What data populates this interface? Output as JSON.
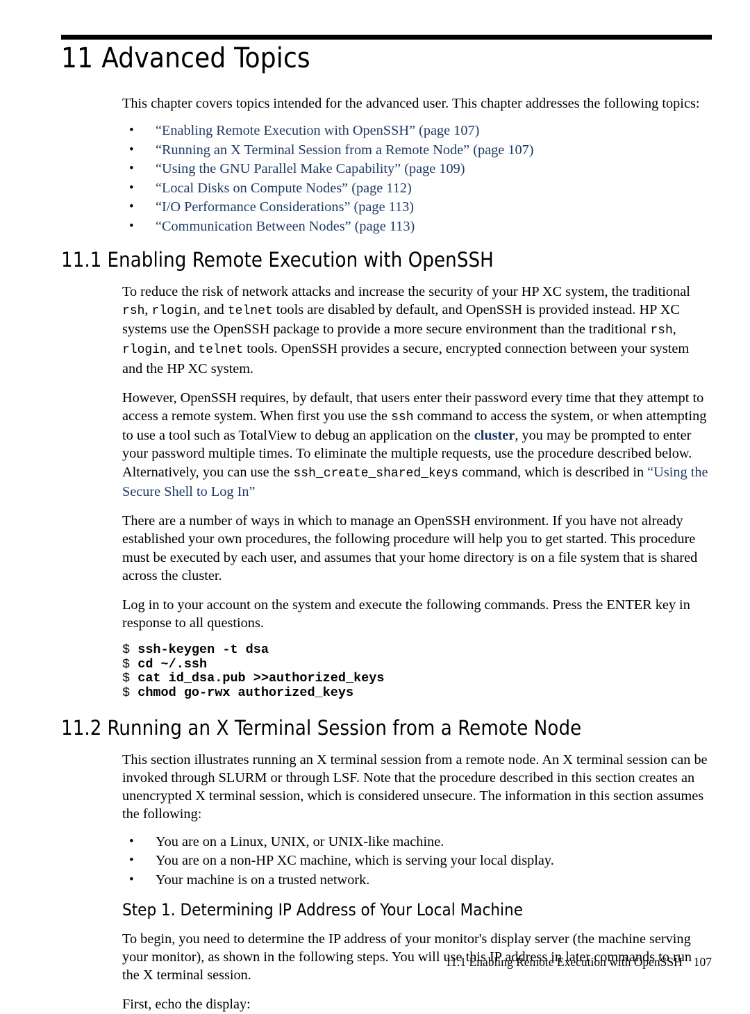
{
  "document": {
    "chapter_number": "11",
    "chapter_title": "Advanced Topics",
    "intro": "This chapter covers topics intended for the advanced user. This chapter addresses the following topics:",
    "topic_links": [
      "“Enabling Remote Execution with OpenSSH” (page 107)",
      "“Running an X Terminal Session from a Remote Node” (page 107)",
      "“Using the GNU Parallel Make Capability” (page 109)",
      "“Local Disks on Compute Nodes” (page 112)",
      "“I/O Performance Considerations” (page 113)",
      "“Communication Between Nodes” (page 113)"
    ]
  },
  "section_11_1": {
    "number": "11.1",
    "title": "Enabling Remote Execution with OpenSSH",
    "para1": {
      "t1": "To reduce the risk of network attacks and increase the security of your HP XC system, the traditional ",
      "c1": "rsh",
      "t2": ", ",
      "c2": "rlogin",
      "t3": ", and ",
      "c3": "telnet",
      "t4": " tools are disabled by default, and OpenSSH is provided instead. HP XC systems use the OpenSSH package to provide a more secure environment than the traditional ",
      "c4": "rsh",
      "t5": ", ",
      "c5": "rlogin",
      "t6": ", and ",
      "c6": "telnet",
      "t7": " tools. OpenSSH provides a secure, encrypted connection between your system and the HP XC system."
    },
    "para2": {
      "t1": "However, OpenSSH requires, by default, that users enter their password every time that they attempt to access a remote system. When first you use the ",
      "c1": "ssh",
      "t2": " command to access the system, or when attempting to use a tool such as TotalView to debug an application on the ",
      "term": "cluster",
      "t3": ", you may be prompted to enter your password multiple times. To eliminate the multiple requests, use the procedure described below. Alternatively, you can use the ",
      "c2": "ssh_create_shared_keys",
      "t4": " command, which is described in ",
      "link": "“Using the Secure Shell to Log In”"
    },
    "para3": "There are a number of ways in which to manage an OpenSSH environment. If you have not already established your own procedures, the following procedure will help you to get started. This procedure must be executed by each user, and assumes that your home directory is on a file system that is shared across the cluster.",
    "para4": "Log in to your account on the system and execute the following commands. Press the ENTER key in response to all questions.",
    "code_lines": [
      {
        "prompt": "$",
        "command": "ssh-keygen -t dsa"
      },
      {
        "prompt": "$",
        "command": "cd ~/.ssh"
      },
      {
        "prompt": "$",
        "command": "cat id_dsa.pub >>authorized_keys"
      },
      {
        "prompt": "$",
        "command": "chmod go-rwx authorized_keys"
      }
    ]
  },
  "section_11_2": {
    "number": "11.2",
    "title": "Running an X Terminal Session from a Remote Node",
    "para1": "This section illustrates running an X terminal session from a remote node. An X terminal session can be invoked through SLURM or through LSF. Note that the procedure described in this section creates an unencrypted X terminal session, which is considered unsecure. The information in this section assumes the following:",
    "assumptions": [
      "You are on a Linux, UNIX, or UNIX-like machine.",
      "You are on a non-HP XC machine, which is serving your local display.",
      "Your machine is on a trusted network."
    ],
    "step1": {
      "title": "Step 1. Determining IP Address of Your Local Machine",
      "para1": "To begin, you need to determine the IP address of your monitor's display server (the machine serving your monitor), as shown in the following steps. You will use this IP address in later commands to run the X terminal session.",
      "para2": "First, echo the display:"
    }
  },
  "footer": {
    "text": "11.1 Enabling Remote Execution with OpenSSH",
    "page_number": "107"
  },
  "colors": {
    "link": "#1f3a66",
    "term": "#1c3461",
    "rule": "#000000",
    "text": "#000000"
  }
}
